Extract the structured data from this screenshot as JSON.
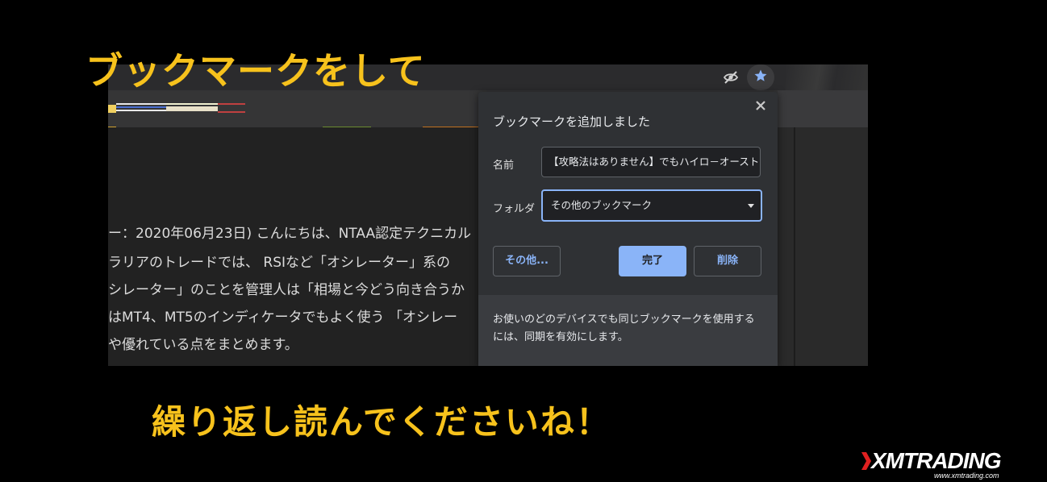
{
  "headings": {
    "top": "ブックマークをして",
    "bottom": "繰り返し読んでくださいね！"
  },
  "toolbar": {
    "tracking_icon": "eye-off-icon",
    "bookmark_icon": "star-icon"
  },
  "article": {
    "lines": [
      "ー：2020年06月23日) こんにちは、NTAA認定テクニカル",
      "ラリアのトレードでは、 RSIなど「オシレーター」系の",
      "シレーター」のことを管理人は「相場と今どう向き合うか",
      "はMT4、MT5のインディケータでもよく使う 「オシレー",
      "や優れている点をまとめます。"
    ]
  },
  "dialog": {
    "title": "ブックマークを追加しました",
    "close_icon": "close-icon",
    "name_label": "名前",
    "name_value": "【攻略法はありません】でもハイロ－オーストラリア",
    "folder_label": "フォルダ",
    "folder_value": "その他のブックマーク",
    "more_button": "その他...",
    "done_button": "完了",
    "delete_button": "削除",
    "footer_text": "お使いのどのデバイスでも同じブックマークを使用するには、同期を有効にします。"
  },
  "logo": {
    "brand": "XMTRADING",
    "url": "www.xmtrading.com"
  },
  "colors": {
    "heading": "#f7c21c",
    "accent_blue": "#8ab4f8",
    "dialog_bg": "#2f3134"
  }
}
